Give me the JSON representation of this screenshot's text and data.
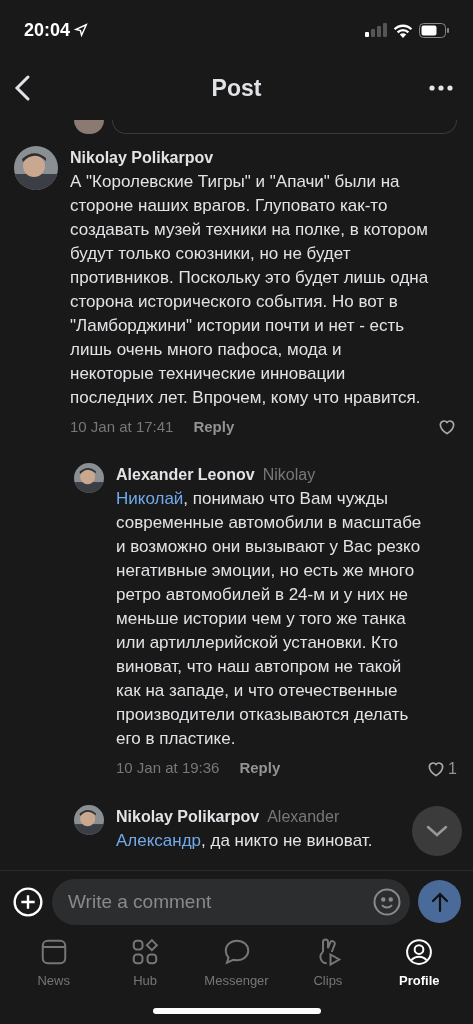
{
  "status_bar": {
    "time": "20:04"
  },
  "header": {
    "title": "Post"
  },
  "comments": [
    {
      "author": "Nikolay Polikarpov",
      "text": "А \"Королевские Тигры\" и \"Апачи\" были на стороне наших врагов. Глуповато как-то создавать музей техники на полке, в котором будут только союзники, но не будет противников. Поскольку это будет лишь одна сторона исторического события. Но вот в \"Ламборджини\" истории почти и нет - есть лишь очень много пафоса, мода и некоторые технические инновации последних лет. Впрочем, кому что нравится.",
      "time": "10 Jan at 17:41",
      "reply": "Reply",
      "nested": false
    },
    {
      "author": "Alexander Leonov",
      "reply_to": "Nikolay",
      "mention": "Николай",
      "text": ", понимаю что Вам чужды современные автомобили в масштабе и возможно они вызывают у Вас резко негативные эмоции, но есть же много ретро автомобилей в 24-м и у них не меньше истории чем у того же танка или артиллерийской установки. Кто виноват, что наш автопром не такой как на западе, и что отечественные производители отказываются делать его в пластике.",
      "time": "10 Jan at 19:36",
      "reply": "Reply",
      "likes": "1",
      "nested": true
    },
    {
      "author": "Nikolay Polikarpov",
      "reply_to": "Alexander",
      "mention": "Александр",
      "text": ", да никто не виноват.",
      "nested": true
    }
  ],
  "composer": {
    "placeholder": "Write a comment"
  },
  "tabs": [
    {
      "kind": "news",
      "label": "News",
      "selected": false
    },
    {
      "kind": "hub",
      "label": "Hub",
      "selected": false
    },
    {
      "kind": "messenger",
      "label": "Messenger",
      "selected": false
    },
    {
      "kind": "clips",
      "label": "Clips",
      "selected": false
    },
    {
      "kind": "profile",
      "label": "Profile",
      "selected": true
    }
  ]
}
